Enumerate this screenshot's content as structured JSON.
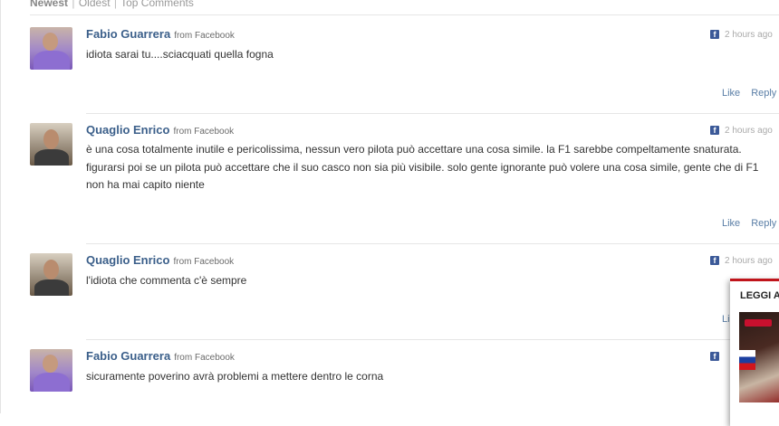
{
  "sort": {
    "newest": "Newest",
    "separator": "|",
    "oldest": "Oldest",
    "top": "Top Comments"
  },
  "comments": [
    {
      "author": "Fabio Guarrera",
      "via": "from Facebook",
      "time": "2 hours ago",
      "text": "idiota sarai tu....sciacquati quella fogna",
      "like": "Like",
      "reply": "Reply",
      "avatar": "avatar-fabio"
    },
    {
      "author": "Quaglio Enrico",
      "via": "from Facebook",
      "time": "2 hours ago",
      "text": "è una cosa totalmente inutile e pericolissima, nessun vero pilota può accettare una cosa simile. la F1 sarebbe compeltamente snaturata. figurarsi poi se un pilota può accettare che il suo casco non sia più visibile. solo gente ignorante può volere una cosa simile, gente che di F1 non ha mai capito niente",
      "like": "Like",
      "reply": "Reply",
      "avatar": "avatar-enrico"
    },
    {
      "author": "Quaglio Enrico",
      "via": "from Facebook",
      "time": "2 hours ago",
      "text": "l'idiota che commenta c'è sempre",
      "like": "Li",
      "reply": "",
      "avatar": "avatar-enrico"
    },
    {
      "author": "Fabio Guarrera",
      "via": "from Facebook",
      "time": "",
      "text": "sicuramente poverino avrà problemi a mettere dentro le corna",
      "like": "",
      "reply": "",
      "avatar": "avatar-fabio"
    }
  ],
  "popup": {
    "title": "LEGGI A",
    "accent": "#c0141b"
  },
  "icons": {
    "facebook": "facebook-icon"
  },
  "colors": {
    "author": "#3b5f8a",
    "link": "#5a7ea6",
    "facebook": "#3b5998"
  }
}
